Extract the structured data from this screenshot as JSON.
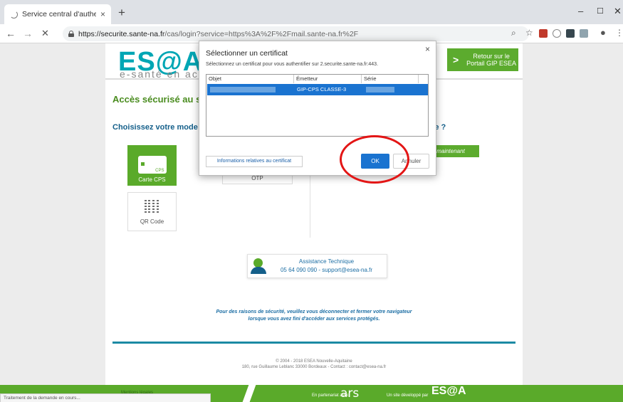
{
  "browser": {
    "tab_title": "Service central d'authentification",
    "tab_close": "×",
    "new_tab": "+",
    "window_controls": [
      "–",
      "☐",
      "✕"
    ],
    "nav": {
      "back": "←",
      "forward": "→",
      "stop": "✕"
    },
    "url_host": "https://securite.sante-na.fr",
    "url_path": "/cas/login?service=https%3A%2F%2Fmail.sante-na.fr%2F",
    "status_text": "Traitement de la demande en cours..."
  },
  "page": {
    "logo": "ES@A",
    "logo_tagline": "e-santé en actio",
    "return_button": "Retour sur le Portail GIP ESEA",
    "return_arrow": ">",
    "heading": "Accès sécurisé au se",
    "choose_mode": "Choisissez votre mode",
    "choose_mode_right": "ote ?",
    "cards": {
      "cps_chip_text": "CPS",
      "cps_label": "Carte CPS",
      "otp_label": "OTP",
      "qr_label": "QR Code"
    },
    "maintenant_button": "maintenant",
    "assistance": {
      "title": "Assistance Technique",
      "contact": "05 64 090 090 - support@esea-na.fr"
    },
    "security_notice_line1": "Pour des raisons de sécurité, veuillez vous déconnecter et fermer votre navigateur",
    "security_notice_line2": "lorsque vous avez fini d'accéder aux services protégés.",
    "footer_line1": "© 2004 - 2018 ESEA Nouvelle-Aquitaine",
    "footer_line2": "180, rue Guillaume Leblanc 33000 Bordeaux - Contact : contact@esea-na.fr",
    "mentions": "Mentions légales",
    "partner_label": "En partenariat avec",
    "partner_logo": "ars",
    "developer_label": "Un site développé par",
    "developer_logo": "ES@A"
  },
  "dialog": {
    "title": "Sélectionner un certificat",
    "subtitle": "Sélectionnez un certificat pour vous authentifier sur 2.securite.sante-na.fr:443.",
    "close": "×",
    "columns": [
      "Objet",
      "Émetteur",
      "Série"
    ],
    "selected_row": {
      "issuer": "GIP-CPS CLASSE-3"
    },
    "info_button": "Informations relatives au certificat",
    "ok_button": "OK",
    "cancel_button": "Annuler"
  },
  "colors": {
    "brand_teal": "#00a6b4",
    "brand_green": "#5aaa2a",
    "selection_blue": "#1a73d0",
    "highlight_red": "#e31515"
  }
}
